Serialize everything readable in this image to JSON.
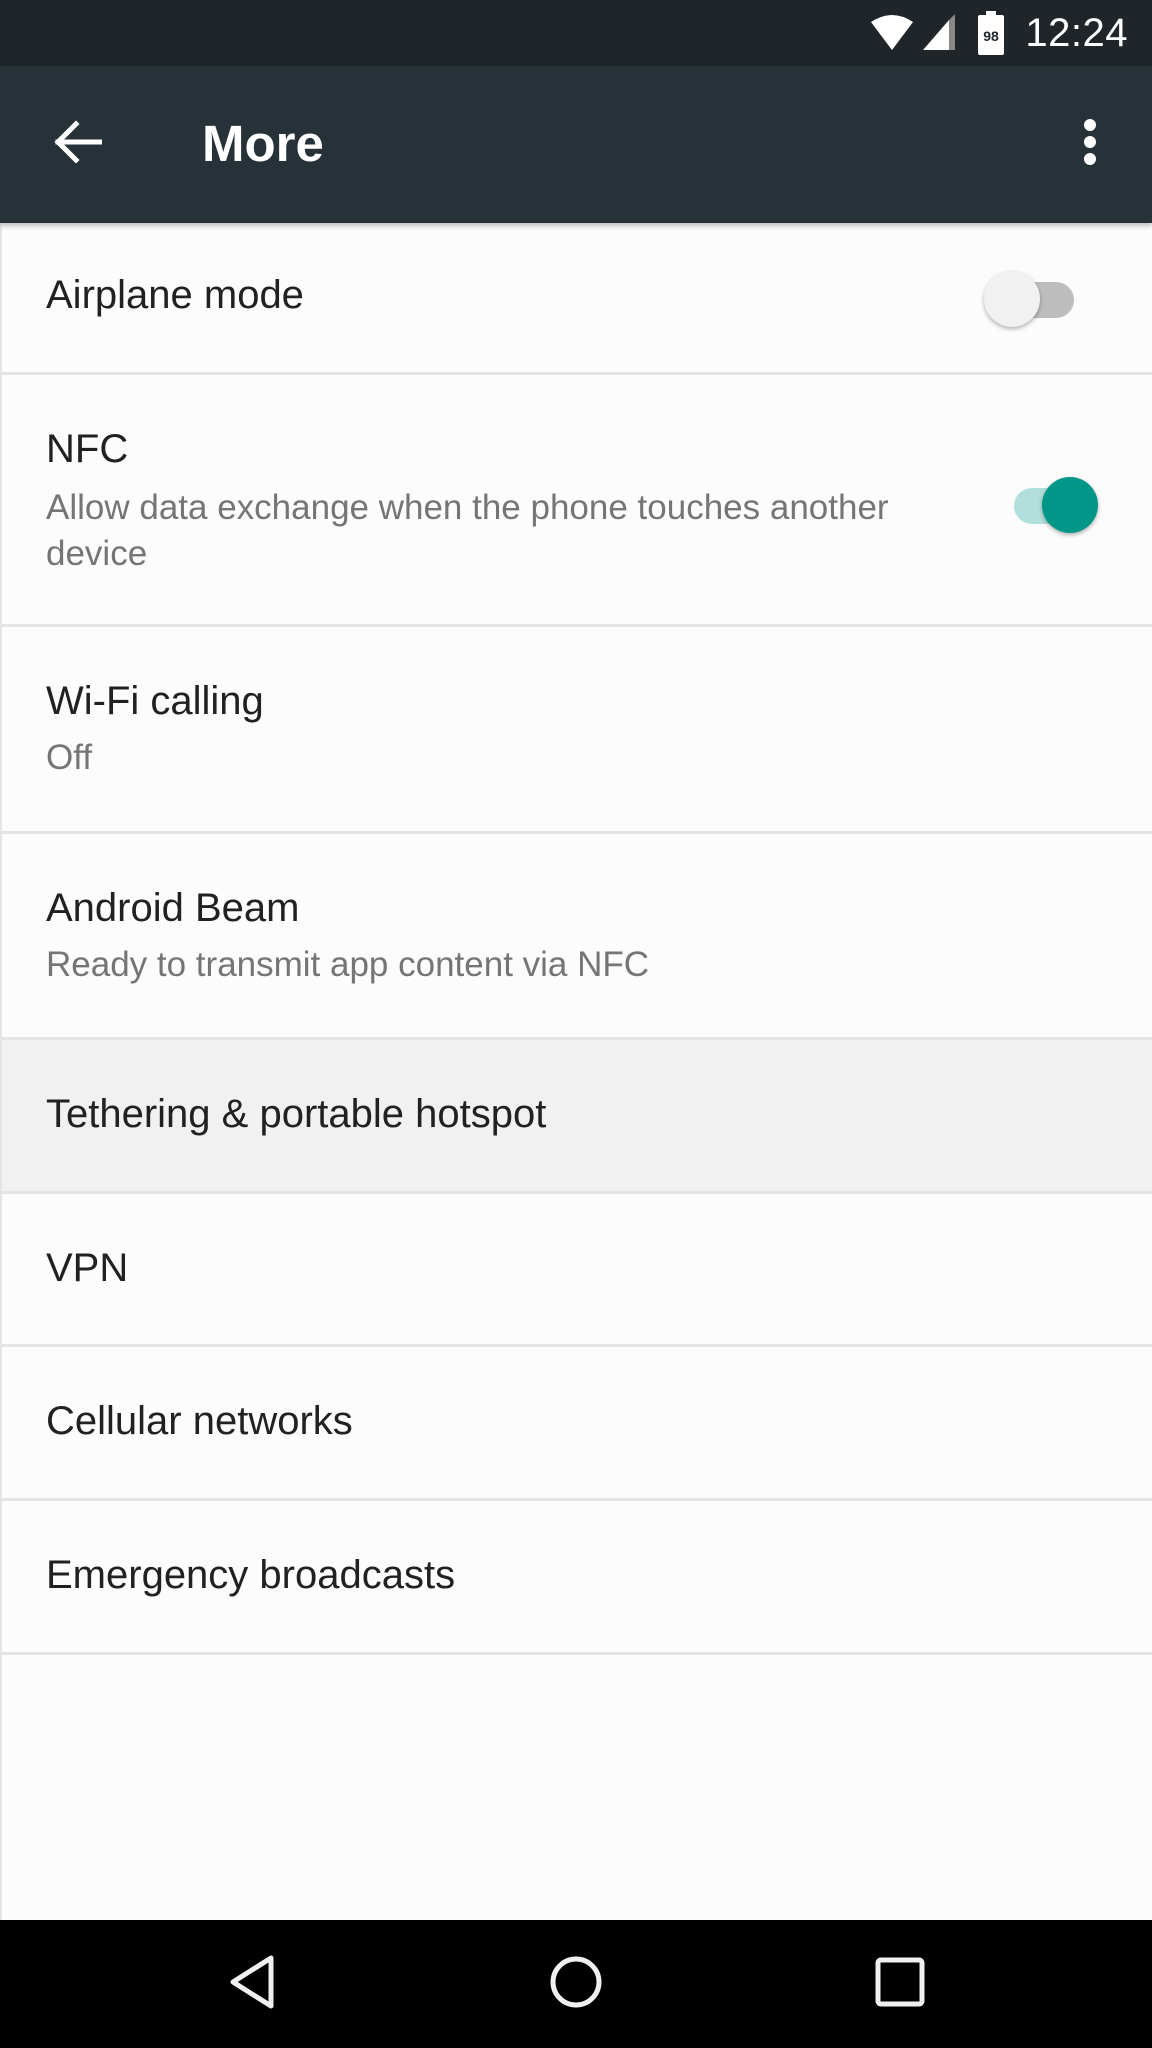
{
  "status_bar": {
    "time": "12:24",
    "battery_level": "98",
    "icons": [
      "wifi-icon",
      "cell-signal-icon",
      "battery-icon"
    ]
  },
  "toolbar": {
    "title": "More",
    "back_icon": "arrow-left-icon",
    "overflow_icon": "more-vertical-icon"
  },
  "settings": [
    {
      "title": "Airplane mode",
      "summary": null,
      "toggle": "off"
    },
    {
      "title": "NFC",
      "summary": "Allow data exchange when the phone touches another device",
      "toggle": "on"
    },
    {
      "title": "Wi-Fi calling",
      "summary": "Off"
    },
    {
      "title": "Android Beam",
      "summary": "Ready to transmit app content via NFC"
    },
    {
      "title": "Tethering & portable hotspot",
      "summary": null,
      "highlighted": true
    },
    {
      "title": "VPN",
      "summary": null
    },
    {
      "title": "Cellular networks",
      "summary": null
    },
    {
      "title": "Emergency broadcasts",
      "summary": null
    }
  ],
  "colors": {
    "toolbar": "#263238",
    "status_bar": "#1f2529",
    "accent": "#009688",
    "accent_track": "#b2dfdb"
  },
  "nav_bar": {
    "buttons": [
      "back-triangle-icon",
      "home-circle-icon",
      "recents-square-icon"
    ]
  }
}
